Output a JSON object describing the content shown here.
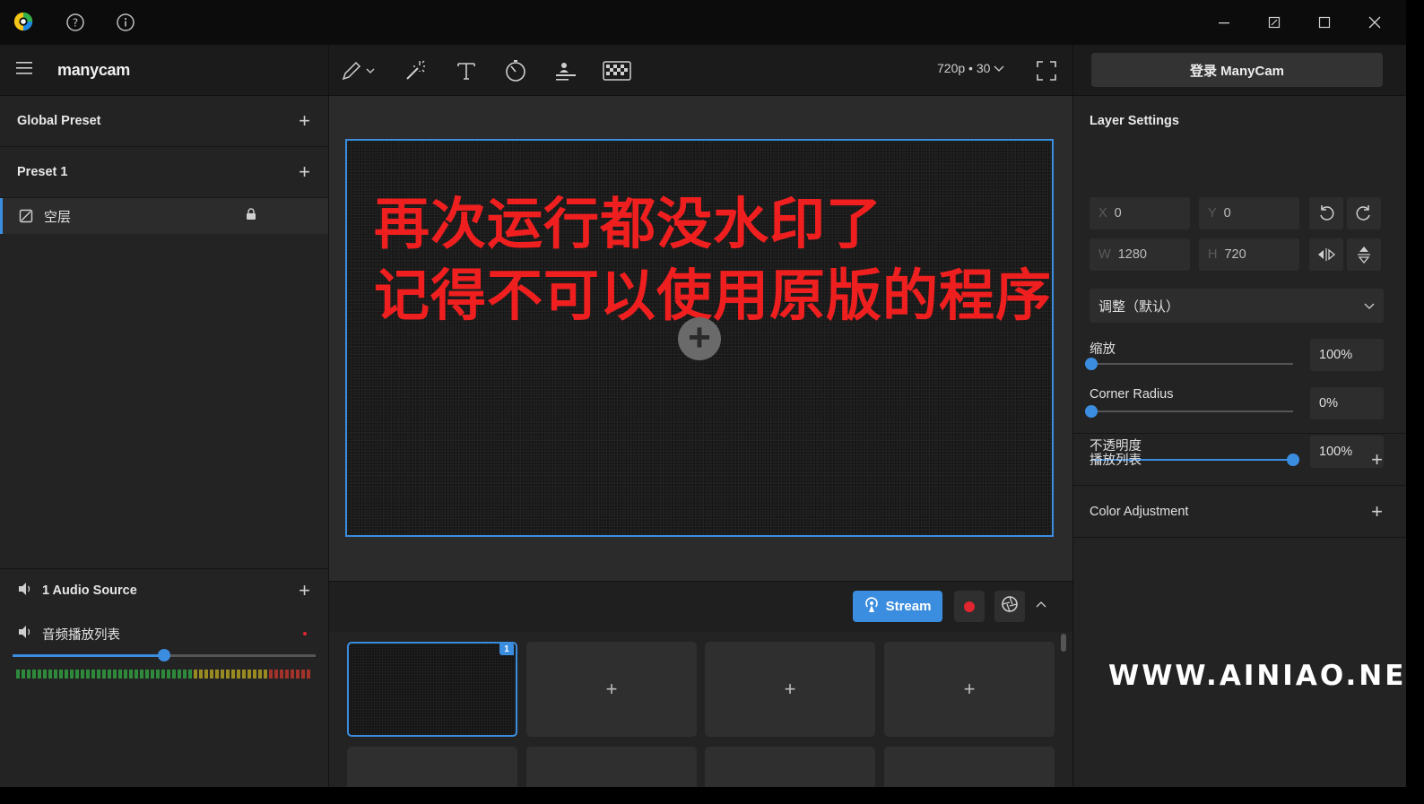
{
  "titlebar": {
    "icons": [
      "manycam-logo-icon",
      "help-icon",
      "info-icon"
    ],
    "window_controls": [
      "minimize-icon",
      "restore-icon",
      "maximize-icon",
      "close-icon"
    ]
  },
  "left_panel": {
    "brand": "manycam",
    "global_preset": "Global Preset",
    "preset_1": "Preset 1",
    "layer": {
      "name": "空层",
      "locked": true
    },
    "audio": {
      "header": "1 Audio Source",
      "source_name": "音频播放列表",
      "volume_fraction": 0.5
    }
  },
  "toolbar": {
    "tools": [
      "draw-icon",
      "magic-wand-icon",
      "text-icon",
      "timer-icon",
      "lower-thirds-icon",
      "chroma-key-icon"
    ],
    "resolution": "720p • 30",
    "fullscreen": "fullscreen-icon"
  },
  "canvas": {
    "overlay_line_1": "再次运行都没水印了",
    "overlay_line_2": "记得不可以使用原版的程序",
    "add_source": "+"
  },
  "stream_bar": {
    "stream_label": "Stream"
  },
  "preset_grid": {
    "badge": "1",
    "add_label": "+"
  },
  "right_panel": {
    "login_label": "登录 ManyCam",
    "layer_settings": {
      "title": "Layer Settings",
      "x_key": "X",
      "x": "0",
      "y_key": "Y",
      "y": "0",
      "w_key": "W",
      "w": "1280",
      "h_key": "H",
      "h": "720",
      "blend_mode": "调整（默认）",
      "zoom_label": "缩放",
      "zoom_value": "100%",
      "zoom_fraction": 0.0,
      "corner_label": "Corner Radius",
      "corner_value": "0%",
      "corner_fraction": 0.0,
      "opacity_label": "不透明度",
      "opacity_value": "100%",
      "opacity_fraction": 1.0
    },
    "playlist": "播放列表",
    "color_adjustment": "Color Adjustment"
  },
  "watermark": "WWW.AINIAO.NET",
  "colors": {
    "accent": "#3b8de0",
    "overlay_text": "#f01f1f",
    "record": "#e0262f"
  }
}
